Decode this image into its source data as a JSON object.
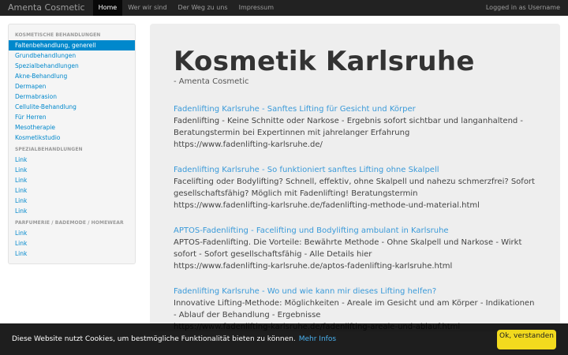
{
  "navbar": {
    "brand": "Amenta Cosmetic",
    "items": [
      "Home",
      "Wer wir sind",
      "Der Weg zu uns",
      "Impressum"
    ],
    "user": "Logged in as Username"
  },
  "sidebar": {
    "sections": [
      {
        "header": "KOSMETISCHE BEHANDLUNGEN",
        "links": [
          "Faltenbehandlung, generell",
          "Grundbehandlungen",
          "Spezialbehandlungen",
          "Akne-Behandlung",
          "Dermapen",
          "Dermabrasion",
          "Cellulite-Behandlung",
          "Für Herren",
          "Mesotherapie",
          "Kosmetikstudio"
        ]
      },
      {
        "header": "SPEZIALBEHANDLUNGEN",
        "links": [
          "Link",
          "Link",
          "Link",
          "Link",
          "Link",
          "Link"
        ]
      },
      {
        "header": "PARFUMERIE / BADEMODE / HOMEWEAR",
        "links": [
          "Link",
          "Link",
          "Link"
        ]
      }
    ]
  },
  "main": {
    "title": "Kosmetik Karlsruhe",
    "subtitle": "- Amenta Cosmetic",
    "results": [
      {
        "title": "Fadenlifting Karlsruhe - Sanftes Lifting für Gesicht und Körper",
        "desc": "Fadenlifting - Keine Schnitte oder Narkose - Ergebnis sofort sichtbar und langanhaltend - Beratungstermin bei Expertinnen mit jahrelanger Erfahrung",
        "url": "https://www.fadenlifting-karlsruhe.de/"
      },
      {
        "title": "Fadenlifting Karlsruhe - So funktioniert sanftes Lifting ohne Skalpell",
        "desc": "Facelifting oder Bodylifting? Schnell, effektiv, ohne Skalpell und nahezu schmerzfrei? Sofort gesellschaftsfähig? Möglich mit Fadenlifting! Beratungstermin",
        "url": "https://www.fadenlifting-karlsruhe.de/fadenlifting-methode-und-material.html"
      },
      {
        "title": "APTOS-Fadenlifting - Facelifting und Bodylifting ambulant in Karlsruhe",
        "desc": "APTOS-Fadenlifting. Die Vorteile: Bewährte Methode - Ohne Skalpell und Narkose - Wirkt sofort - Sofort gesellschaftsfähig - Alle Details hier",
        "url": "https://www.fadenlifting-karlsruhe.de/aptos-fadenlifting-karlsruhe.html"
      },
      {
        "title": "Fadenlifting Karlsruhe - Wo und wie kann mir dieses Lifting helfen?",
        "desc": "Innovative Lifting-Methode: Möglichkeiten - Areale im Gesicht und am Körper - Indikationen - Ablauf der Behandlung - Ergebnisse",
        "url": "https://www.fadenlifting-karlsruhe.de/fadenlifting-areale-und-ablauf.html"
      }
    ]
  },
  "cookie": {
    "text": "Diese Website nutzt Cookies, um bestmögliche Funktionalität bieten zu können.",
    "link": "Mehr Infos",
    "button": "Ok, verstanden"
  },
  "colors": {
    "navbar_bg": "#222222",
    "accent": "#0088cc",
    "hero_bg": "#eeeeee",
    "cookie_button": "#f1d600"
  }
}
